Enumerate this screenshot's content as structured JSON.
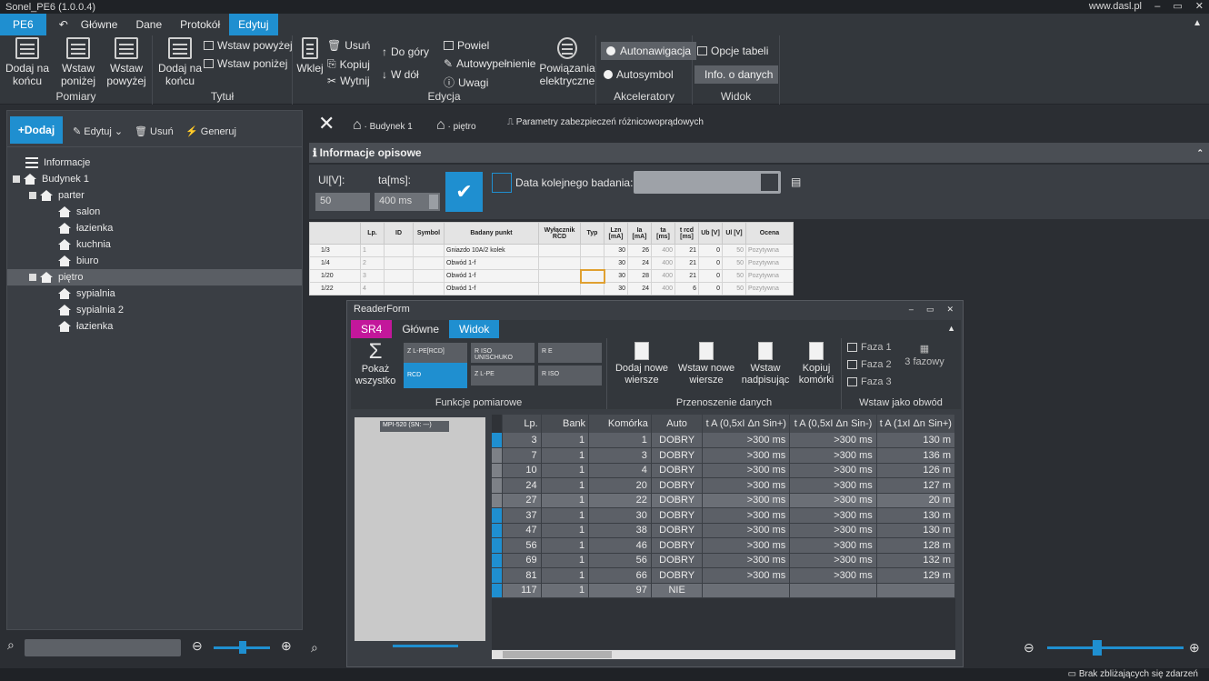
{
  "window": {
    "title": "Sonel_PE6 (1.0.0.4)",
    "site": "www.dasl.pl",
    "controls": [
      "–",
      "▭",
      "✕"
    ]
  },
  "tabs": {
    "app": "PE6",
    "items": [
      "Główne",
      "Dane",
      "Protokół",
      "Edytuj"
    ]
  },
  "ribbon": {
    "pomiary": {
      "label": "Pomiary",
      "add_end": "Dodaj na końcu",
      "insert_below": "Wstaw poniżej",
      "insert_above": "Wstaw powyżej"
    },
    "tytul": {
      "label": "Tytuł",
      "add_end": "Dodaj na końcu",
      "insert_above": "Wstaw powyżej",
      "insert_below": "Wstaw poniżej"
    },
    "edycja": {
      "label": "Edycja",
      "paste": "Wklej",
      "delete": "Usuń",
      "copy": "Kopiuj",
      "cut": "Wytnij",
      "up": "Do góry",
      "down": "W dół",
      "repeat": "Powiel",
      "autofill": "Autowypełnienie",
      "notes": "Uwagi",
      "links": "Powiązania elektryczne"
    },
    "akceleratory": {
      "label": "Akceleratory",
      "autonav": "Autonawigacja",
      "autosymbol": "Autosymbol"
    },
    "widok": {
      "label": "Widok",
      "table_options": "Opcje tabeli",
      "data_info": "Info. o danych"
    }
  },
  "left": {
    "toolbar": {
      "add": "Dodaj",
      "edit": "Edytuj",
      "delete": "Usuń",
      "generate": "Generuj"
    },
    "tree": [
      {
        "label": "Informacje"
      },
      {
        "label": "Budynek 1"
      },
      {
        "label": "parter"
      },
      {
        "label": "salon"
      },
      {
        "label": "łazienka"
      },
      {
        "label": "kuchnia"
      },
      {
        "label": "biuro"
      },
      {
        "label": "piętro"
      },
      {
        "label": "sypialnia"
      },
      {
        "label": "sypialnia 2"
      },
      {
        "label": "łazienka"
      }
    ]
  },
  "main": {
    "crumbs": [
      "Budynek 1",
      "piętro",
      "Parametry zabezpieczeń różnicowoprądowych"
    ],
    "info_title": "Informacje opisowe",
    "ul_label": "Ul[V]:",
    "ul_value": "50",
    "ta_label": "ta[ms]:",
    "ta_value": "400 ms",
    "next_date_label": "Data kolejnego badania:",
    "grid": {
      "headers": [
        "",
        "Lp.",
        "ID",
        "Symbol",
        "Badany punkt",
        "Wyłącznik RCD",
        "Typ",
        "Lzn [mA]",
        "Ia [mA]",
        "ta [ms]",
        "t rcd [ms]",
        "Ub [V]",
        "Ul [V]",
        "Ocena"
      ],
      "rows": [
        [
          "1/3",
          "1",
          "",
          "",
          "Gniazdo 10A/2 kolek",
          "",
          "",
          "30",
          "26",
          "400",
          "21",
          "0",
          "50",
          "Pozytywna"
        ],
        [
          "1/4",
          "2",
          "",
          "",
          "Obwód 1-f",
          "",
          "",
          "30",
          "24",
          "400",
          "21",
          "0",
          "50",
          "Pozytywna"
        ],
        [
          "1/20",
          "3",
          "",
          "",
          "Obwód 1-f",
          "",
          "",
          "30",
          "28",
          "400",
          "21",
          "0",
          "50",
          "Pozytywna"
        ],
        [
          "1/22",
          "4",
          "",
          "",
          "Obwód 1-f",
          "",
          "",
          "30",
          "24",
          "400",
          "6",
          "0",
          "50",
          "Pozytywna"
        ]
      ]
    }
  },
  "reader": {
    "title": "ReaderForm",
    "tabs": [
      "SR4",
      "Główne",
      "Widok"
    ],
    "show_all": "Pokaż wszystko",
    "functions_label": "Funkcje pomiarowe",
    "functions": [
      "Z L-PE[RCD]",
      "R ISO UNISCHUKO",
      "R E",
      "RCD",
      "Z L-PE",
      "R ISO"
    ],
    "transfer_label": "Przenoszenie danych",
    "add_rows": "Dodaj nowe wiersze",
    "insert_rows": "Wstaw nowe wiersze",
    "insert_overwrite": "Wstaw nadpisując",
    "copy_cells": "Kopiuj komórki",
    "circuit_label": "Wstaw jako obwód",
    "phases": [
      "Faza 1",
      "Faza 2",
      "Faza 3"
    ],
    "three_phase": "3 fazowy",
    "device": "MPI-520 (SN: ---)",
    "table": {
      "headers": [
        "Lp.",
        "Bank",
        "Komórka",
        "Auto",
        "t A (0,5xI Δn Sin+)",
        "t A (0,5xI Δn Sin-)",
        "t A (1xI Δn Sin+)"
      ],
      "rows": [
        [
          "3",
          "1",
          "1",
          "DOBRY",
          ">300 ms",
          ">300 ms",
          "130 m"
        ],
        [
          "7",
          "1",
          "3",
          "DOBRY",
          ">300 ms",
          ">300 ms",
          "136 m"
        ],
        [
          "10",
          "1",
          "4",
          "DOBRY",
          ">300 ms",
          ">300 ms",
          "126 m"
        ],
        [
          "24",
          "1",
          "20",
          "DOBRY",
          ">300 ms",
          ">300 ms",
          "127 m"
        ],
        [
          "27",
          "1",
          "22",
          "DOBRY",
          ">300 ms",
          ">300 ms",
          "20 m"
        ],
        [
          "37",
          "1",
          "30",
          "DOBRY",
          ">300 ms",
          ">300 ms",
          "130 m"
        ],
        [
          "47",
          "1",
          "38",
          "DOBRY",
          ">300 ms",
          ">300 ms",
          "130 m"
        ],
        [
          "56",
          "1",
          "46",
          "DOBRY",
          ">300 ms",
          ">300 ms",
          "128 m"
        ],
        [
          "69",
          "1",
          "56",
          "DOBRY",
          ">300 ms",
          ">300 ms",
          "132 m"
        ],
        [
          "81",
          "1",
          "66",
          "DOBRY",
          ">300 ms",
          ">300 ms",
          "129 m"
        ],
        [
          "117",
          "1",
          "97",
          "NIE",
          "",
          "",
          ""
        ]
      ]
    }
  },
  "status": {
    "message": "Brak zbliżających się zdarzeń"
  },
  "colors": {
    "accent": "#1f8fd0",
    "sr4": "#c3179b",
    "bg": "#2b2e33"
  }
}
